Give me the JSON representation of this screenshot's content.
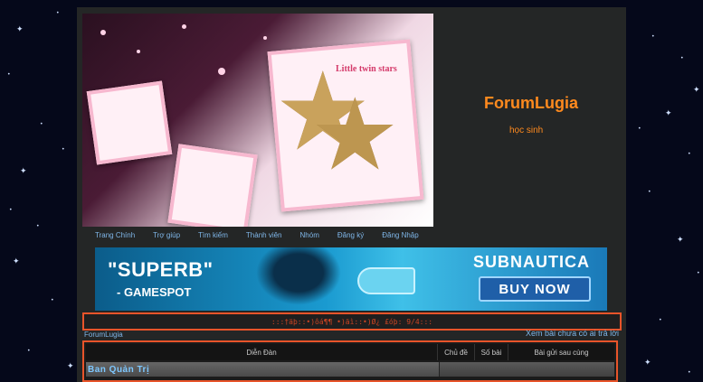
{
  "header": {
    "site_title": "ForumLugia",
    "site_description": "học sinh",
    "banner_caption": "Little twin stars"
  },
  "nav": {
    "items": [
      {
        "label": "Trang Chính"
      },
      {
        "label": "Trợ giúp"
      },
      {
        "label": "Tìm kiếm"
      },
      {
        "label": "Thành viên"
      },
      {
        "label": "Nhóm"
      },
      {
        "label": "Đăng ký"
      },
      {
        "label": "Đăng Nhập"
      }
    ]
  },
  "ad": {
    "quote": "\"SUPERB\"",
    "source": "- GAMESPOT",
    "brand": "SUBNAUTICA",
    "cta": "BUY NOW"
  },
  "marquee": {
    "text": ":::†äþ::•)ôá¶¶ •)äì::•)Ø¿ £óþ: 9/4:::"
  },
  "breadcrumb": {
    "home": "ForumLugia"
  },
  "links": {
    "unanswered": "Xem bài chưa có ai trả lời"
  },
  "table": {
    "headers": {
      "forum": "Diễn Đàn",
      "topics": "Chủ đề",
      "posts": "Số bài",
      "last_post": "Bài gửi sau cùng"
    },
    "categories": [
      {
        "name": "Ban Quản Trị"
      }
    ]
  },
  "colors": {
    "accent_orange": "#ff8a1e",
    "border_red": "#e8542a",
    "link_blue": "#7fb6e8",
    "category_blue": "#7ec8ff"
  }
}
